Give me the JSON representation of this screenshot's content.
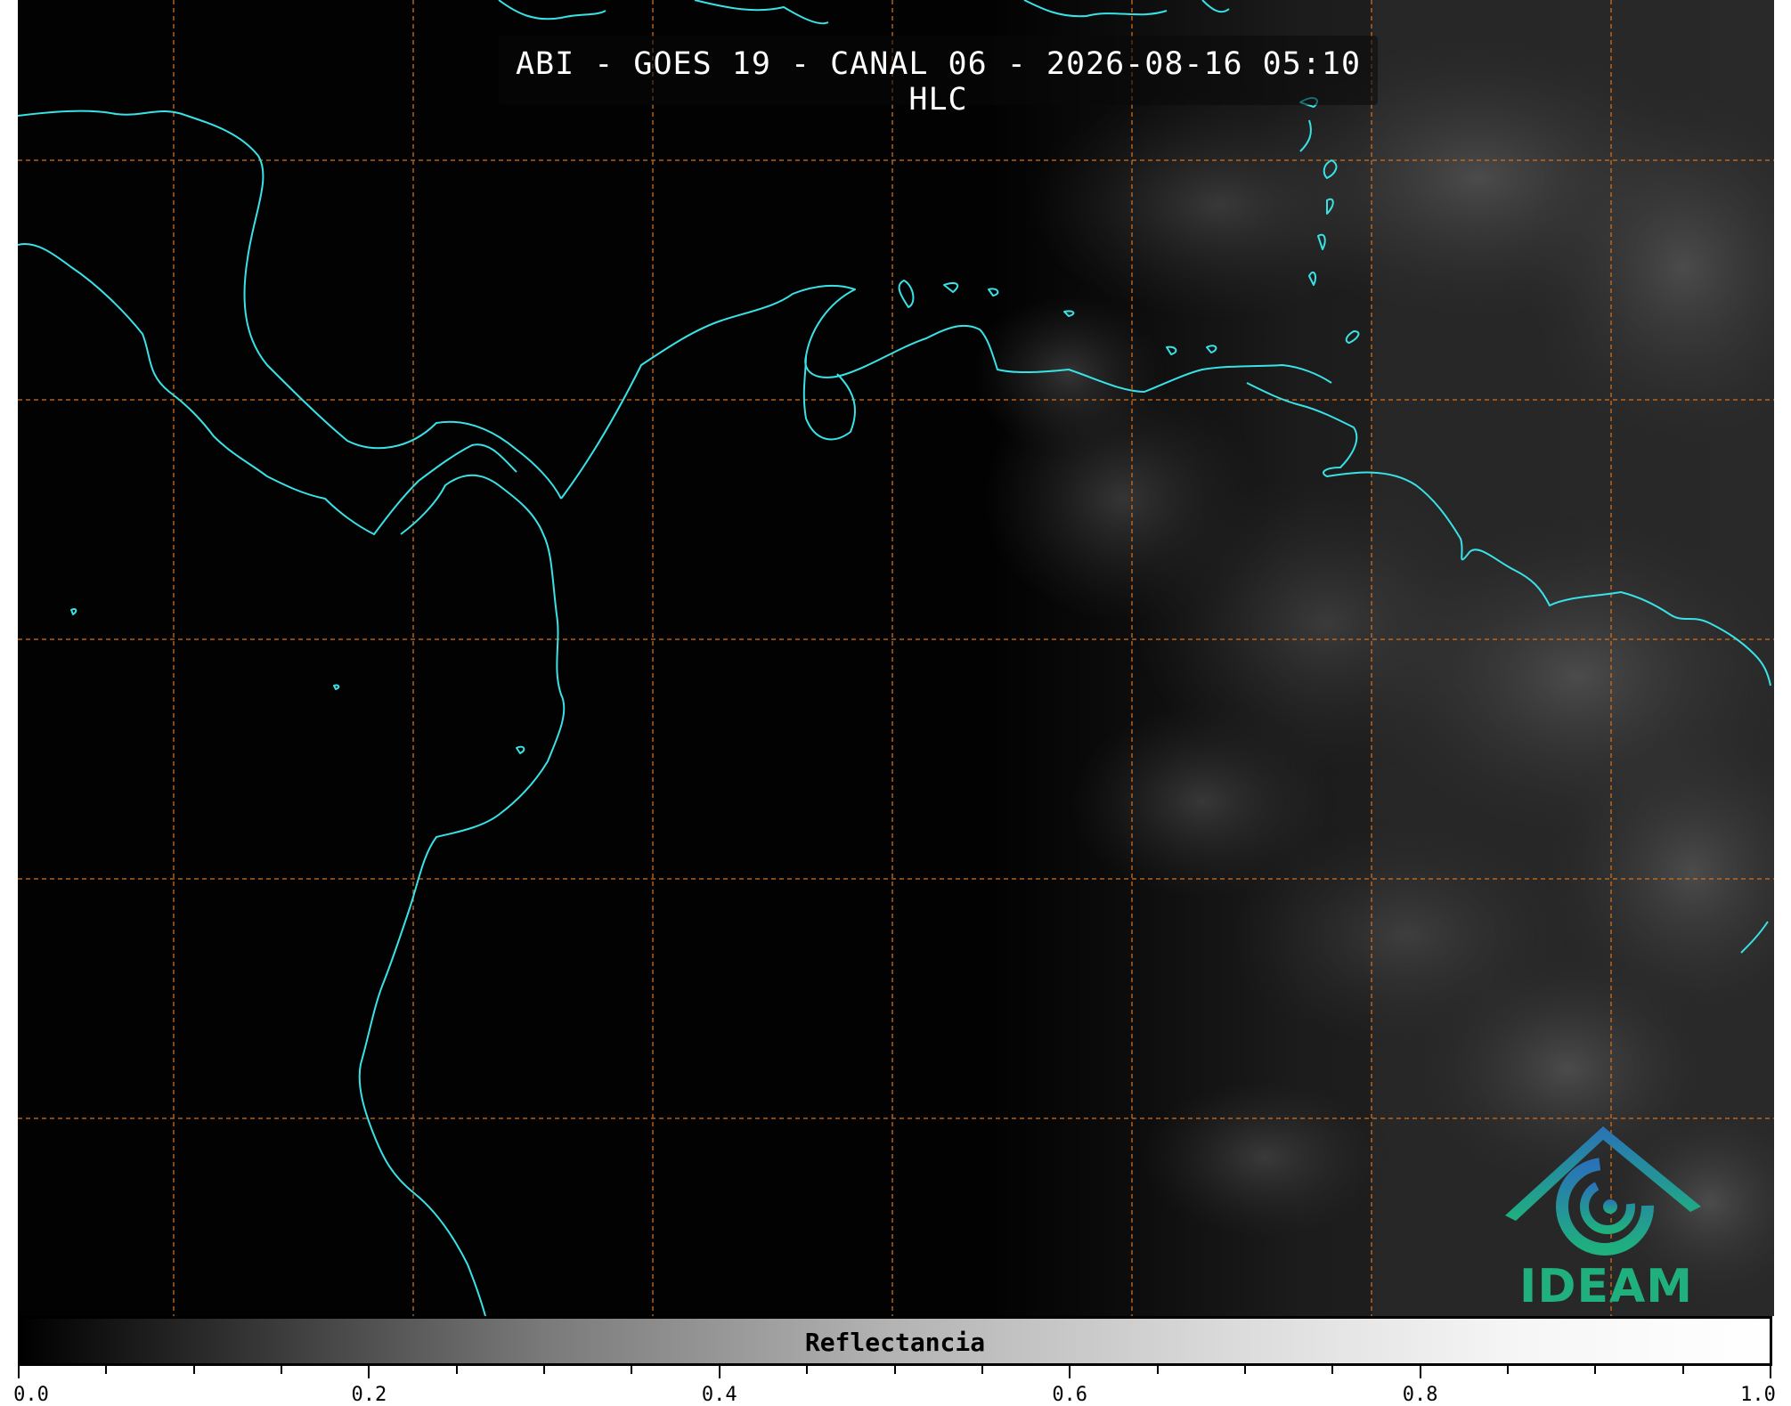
{
  "map": {
    "title": "ABI - GOES 19 - CANAL 06 - 2026-08-16 05:10 HLC",
    "coastline_color": "#38e2e6",
    "gridline_color": "#d2701e",
    "background_color": "#020202"
  },
  "logo": {
    "text": "IDEAM",
    "color_primary": "#1fb07e",
    "color_secondary": "#2a72b8"
  },
  "colorbar": {
    "label": "Reflectancia",
    "min": 0.0,
    "max": 1.0,
    "tick_labels": [
      "0.0",
      "0.2",
      "0.4",
      "0.6",
      "0.8",
      "1.0"
    ],
    "minor_ticks_per_major": 4,
    "colormap": "gray"
  }
}
